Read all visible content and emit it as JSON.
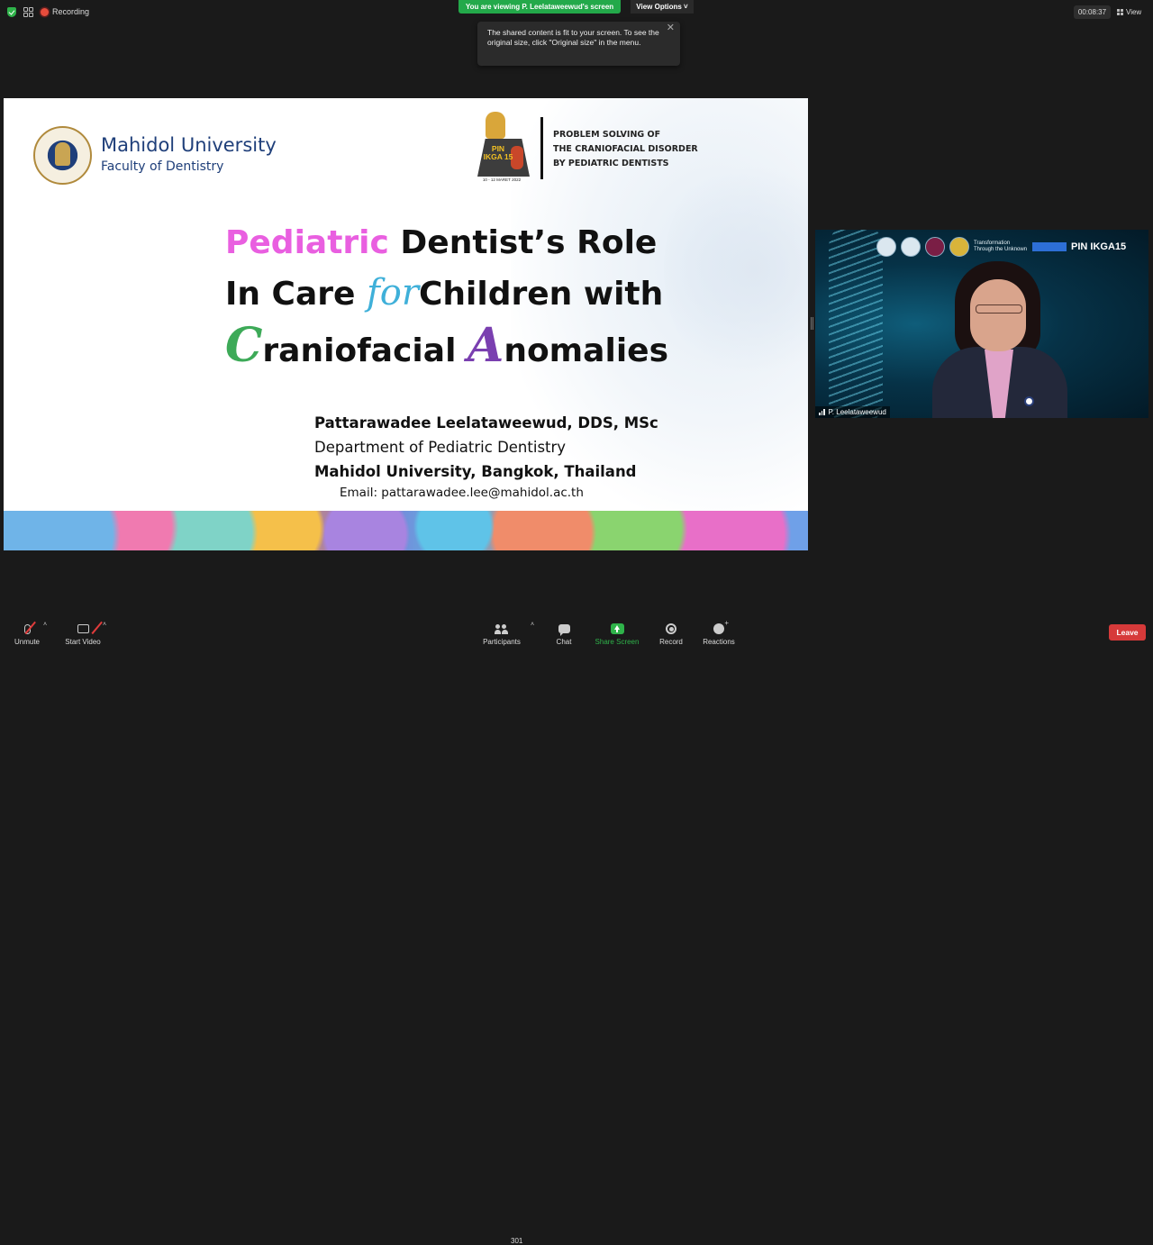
{
  "topbar": {
    "recording_label": "Recording",
    "viewing_banner": "You are viewing P. Leelataweewud's screen",
    "view_options_label": "View Options ˅",
    "tooltip_text": "The shared content is fit to your screen. To see the original size, click \"Original size\" in the menu.",
    "close_glyph": "✕",
    "timer": "00:08:37",
    "view_label": "View"
  },
  "slide": {
    "university_name": "Mahidol University",
    "faculty": "Faculty of Dentistry",
    "event_logo_text": "PIN IKGA 15",
    "event_date": "10 - 12 MARET 2022",
    "subtitle_lines": [
      "PROBLEM SOLVING OF",
      "THE CRANIOFACIAL DISORDER",
      "BY PEDIATRIC DENTISTS"
    ],
    "title": {
      "line1_highlight": "Pediatric",
      "line1_rest": " Dentist’s Role",
      "line2_start": "In Care ",
      "line2_for": "for",
      "line2_end": "Children with",
      "line3_c": "C",
      "line3_mid": "raniofacial ",
      "line3_a": "A",
      "line3_end": "nomalies"
    },
    "author_name": "Pattarawadee Leelataweewud, DDS, MSc",
    "department": "Department of Pediatric Dentistry",
    "affiliation": "Mahidol University, Bangkok, Thailand",
    "email": "Email: pattarawadee.lee@mahidol.ac.th"
  },
  "video": {
    "participant_name": "P. Leelataweewud",
    "logo_text_1": "Transformation Through the Unknown",
    "logo_text_pin": "PIN IKGA15"
  },
  "toolbar": {
    "unmute": "Unmute",
    "start_video": "Start Video",
    "participants": "Participants",
    "participant_count": "301",
    "chat": "Chat",
    "share_screen": "Share Screen",
    "record": "Record",
    "reactions": "Reactions",
    "leave": "Leave",
    "caret": "˄"
  },
  "colors": {
    "accent_green": "#2fb34a",
    "leave_red": "#d63a3a",
    "title_pink": "#e95fe0",
    "title_blue": "#3fb0d9",
    "title_green": "#3daa58",
    "title_purple": "#7a3fb0",
    "mahidol_blue": "#1f3f7a"
  }
}
